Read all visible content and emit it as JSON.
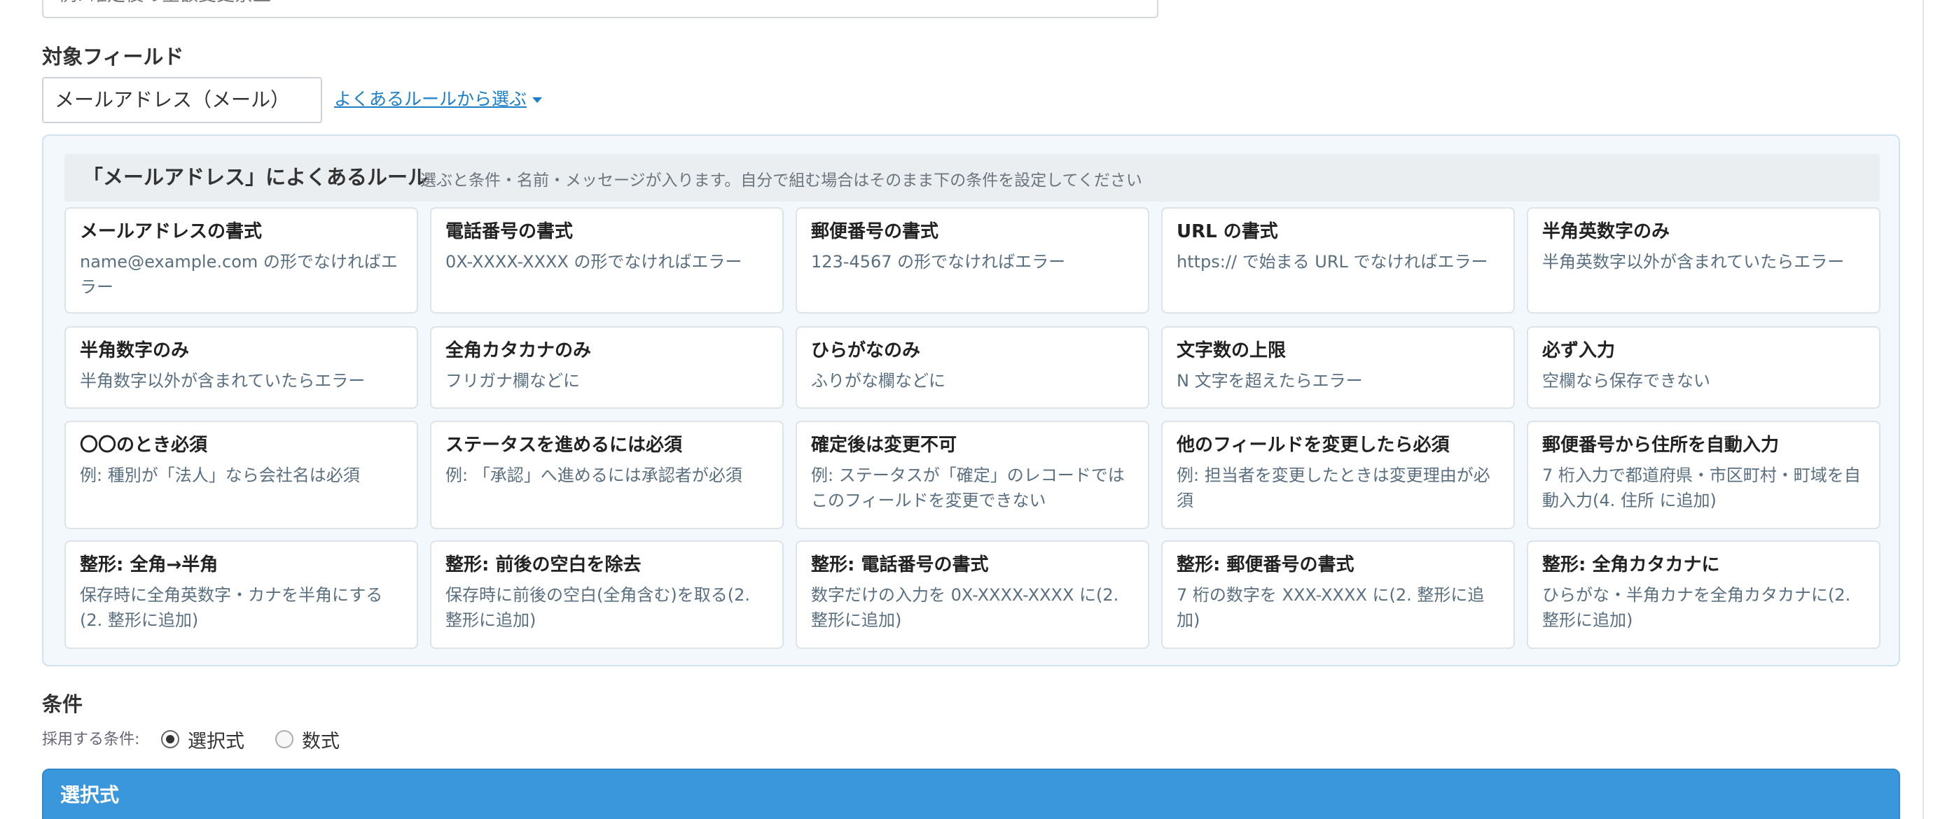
{
  "top_field": {
    "value": "例: 確定後の金額変更禁止"
  },
  "target_field": {
    "label": "対象フィールド",
    "selected": "メールアドレス（メール）",
    "common_rules_link": "よくあるルールから選ぶ"
  },
  "rules_panel": {
    "title": "「メールアドレス」によくあるルール",
    "subtitle": "選ぶと条件・名前・メッセージが入ります。自分で組む場合はそのまま下の条件を設定してください",
    "rules": [
      {
        "title": "メールアドレスの書式",
        "desc": "name@example.com の形でなければエラー"
      },
      {
        "title": "電話番号の書式",
        "desc": "0X-XXXX-XXXX の形でなければエラー"
      },
      {
        "title": "郵便番号の書式",
        "desc": "123-4567 の形でなければエラー"
      },
      {
        "title": "URL の書式",
        "desc": "https:// で始まる URL でなければエラー"
      },
      {
        "title": "半角英数字のみ",
        "desc": "半角英数字以外が含まれていたらエラー"
      },
      {
        "title": "半角数字のみ",
        "desc": "半角数字以外が含まれていたらエラー"
      },
      {
        "title": "全角カタカナのみ",
        "desc": "フリガナ欄などに"
      },
      {
        "title": "ひらがなのみ",
        "desc": "ふりがな欄などに"
      },
      {
        "title": "文字数の上限",
        "desc": "N 文字を超えたらエラー"
      },
      {
        "title": "必ず入力",
        "desc": "空欄なら保存できない"
      },
      {
        "title": "〇〇のとき必須",
        "desc": "例: 種別が「法人」なら会社名は必須"
      },
      {
        "title": "ステータスを進めるには必須",
        "desc": "例: 「承認」へ進めるには承認者が必須"
      },
      {
        "title": "確定後は変更不可",
        "desc": "例: ステータスが「確定」のレコードではこのフィールドを変更できない"
      },
      {
        "title": "他のフィールドを変更したら必須",
        "desc": "例: 担当者を変更したときは変更理由が必須"
      },
      {
        "title": "郵便番号から住所を自動入力",
        "desc": "7 桁入力で都道府県・市区町村・町域を自動入力(4. 住所 に追加)"
      },
      {
        "title": "整形: 全角→半角",
        "desc": "保存時に全角英数字・カナを半角にする(2. 整形に追加)"
      },
      {
        "title": "整形: 前後の空白を除去",
        "desc": "保存時に前後の空白(全角含む)を取る(2. 整形に追加)"
      },
      {
        "title": "整形: 電話番号の書式",
        "desc": "数字だけの入力を 0X-XXXX-XXXX に(2. 整形に追加)"
      },
      {
        "title": "整形: 郵便番号の書式",
        "desc": "7 桁の数字を XXX-XXXX に(2. 整形に追加)"
      },
      {
        "title": "整形: 全角カタカナに",
        "desc": "ひらがな・半角カナを全角カタカナに(2. 整形に追加)"
      }
    ]
  },
  "condition": {
    "label": "条件",
    "mode_label": "採用する条件:",
    "options": [
      {
        "label": "選択式",
        "selected": true
      },
      {
        "label": "数式",
        "selected": false
      }
    ],
    "panel_title": "選択式"
  }
}
